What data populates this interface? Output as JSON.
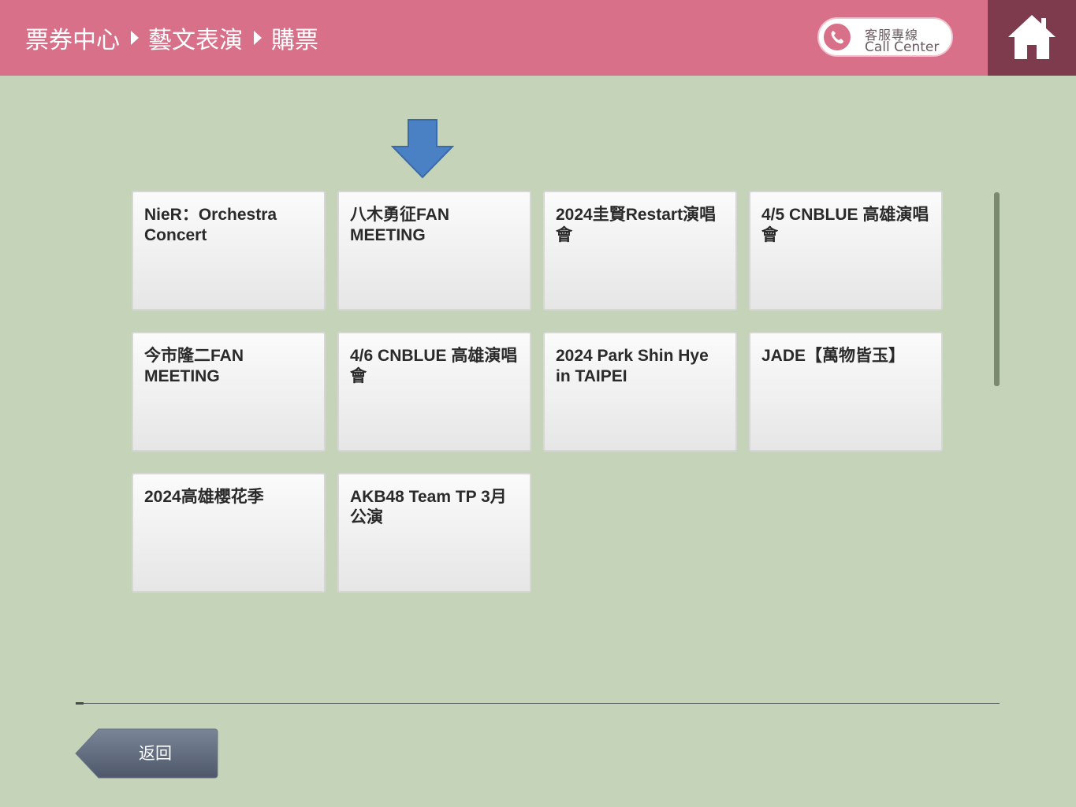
{
  "header": {
    "breadcrumb": [
      "票券中心",
      "藝文表演",
      "購票"
    ],
    "call_center": {
      "label_zh": "客服專線",
      "label_en": "Call Center",
      "icon": "phone-icon"
    },
    "home_icon": "home-icon"
  },
  "events": [
    "NieR：Orchestra Concert",
    "八木勇征FAN MEETING",
    "2024圭賢Restart演唱會",
    "4/5 CNBLUE 高雄演唱會",
    "今市隆二FAN MEETING",
    "4/6 CNBLUE 高雄演唱會",
    "2024 Park Shin Hye in TAIPEI",
    "JADE【萬物皆玉】",
    "2024高雄櫻花季",
    "AKB48 Team TP 3月公演"
  ],
  "back_label": "返回",
  "colors": {
    "header": "#d9708a",
    "home_bg": "#7e3b4d",
    "background": "#c5d4b8",
    "arrow": "#4a80c4",
    "back_button": "#5f6a7e"
  }
}
